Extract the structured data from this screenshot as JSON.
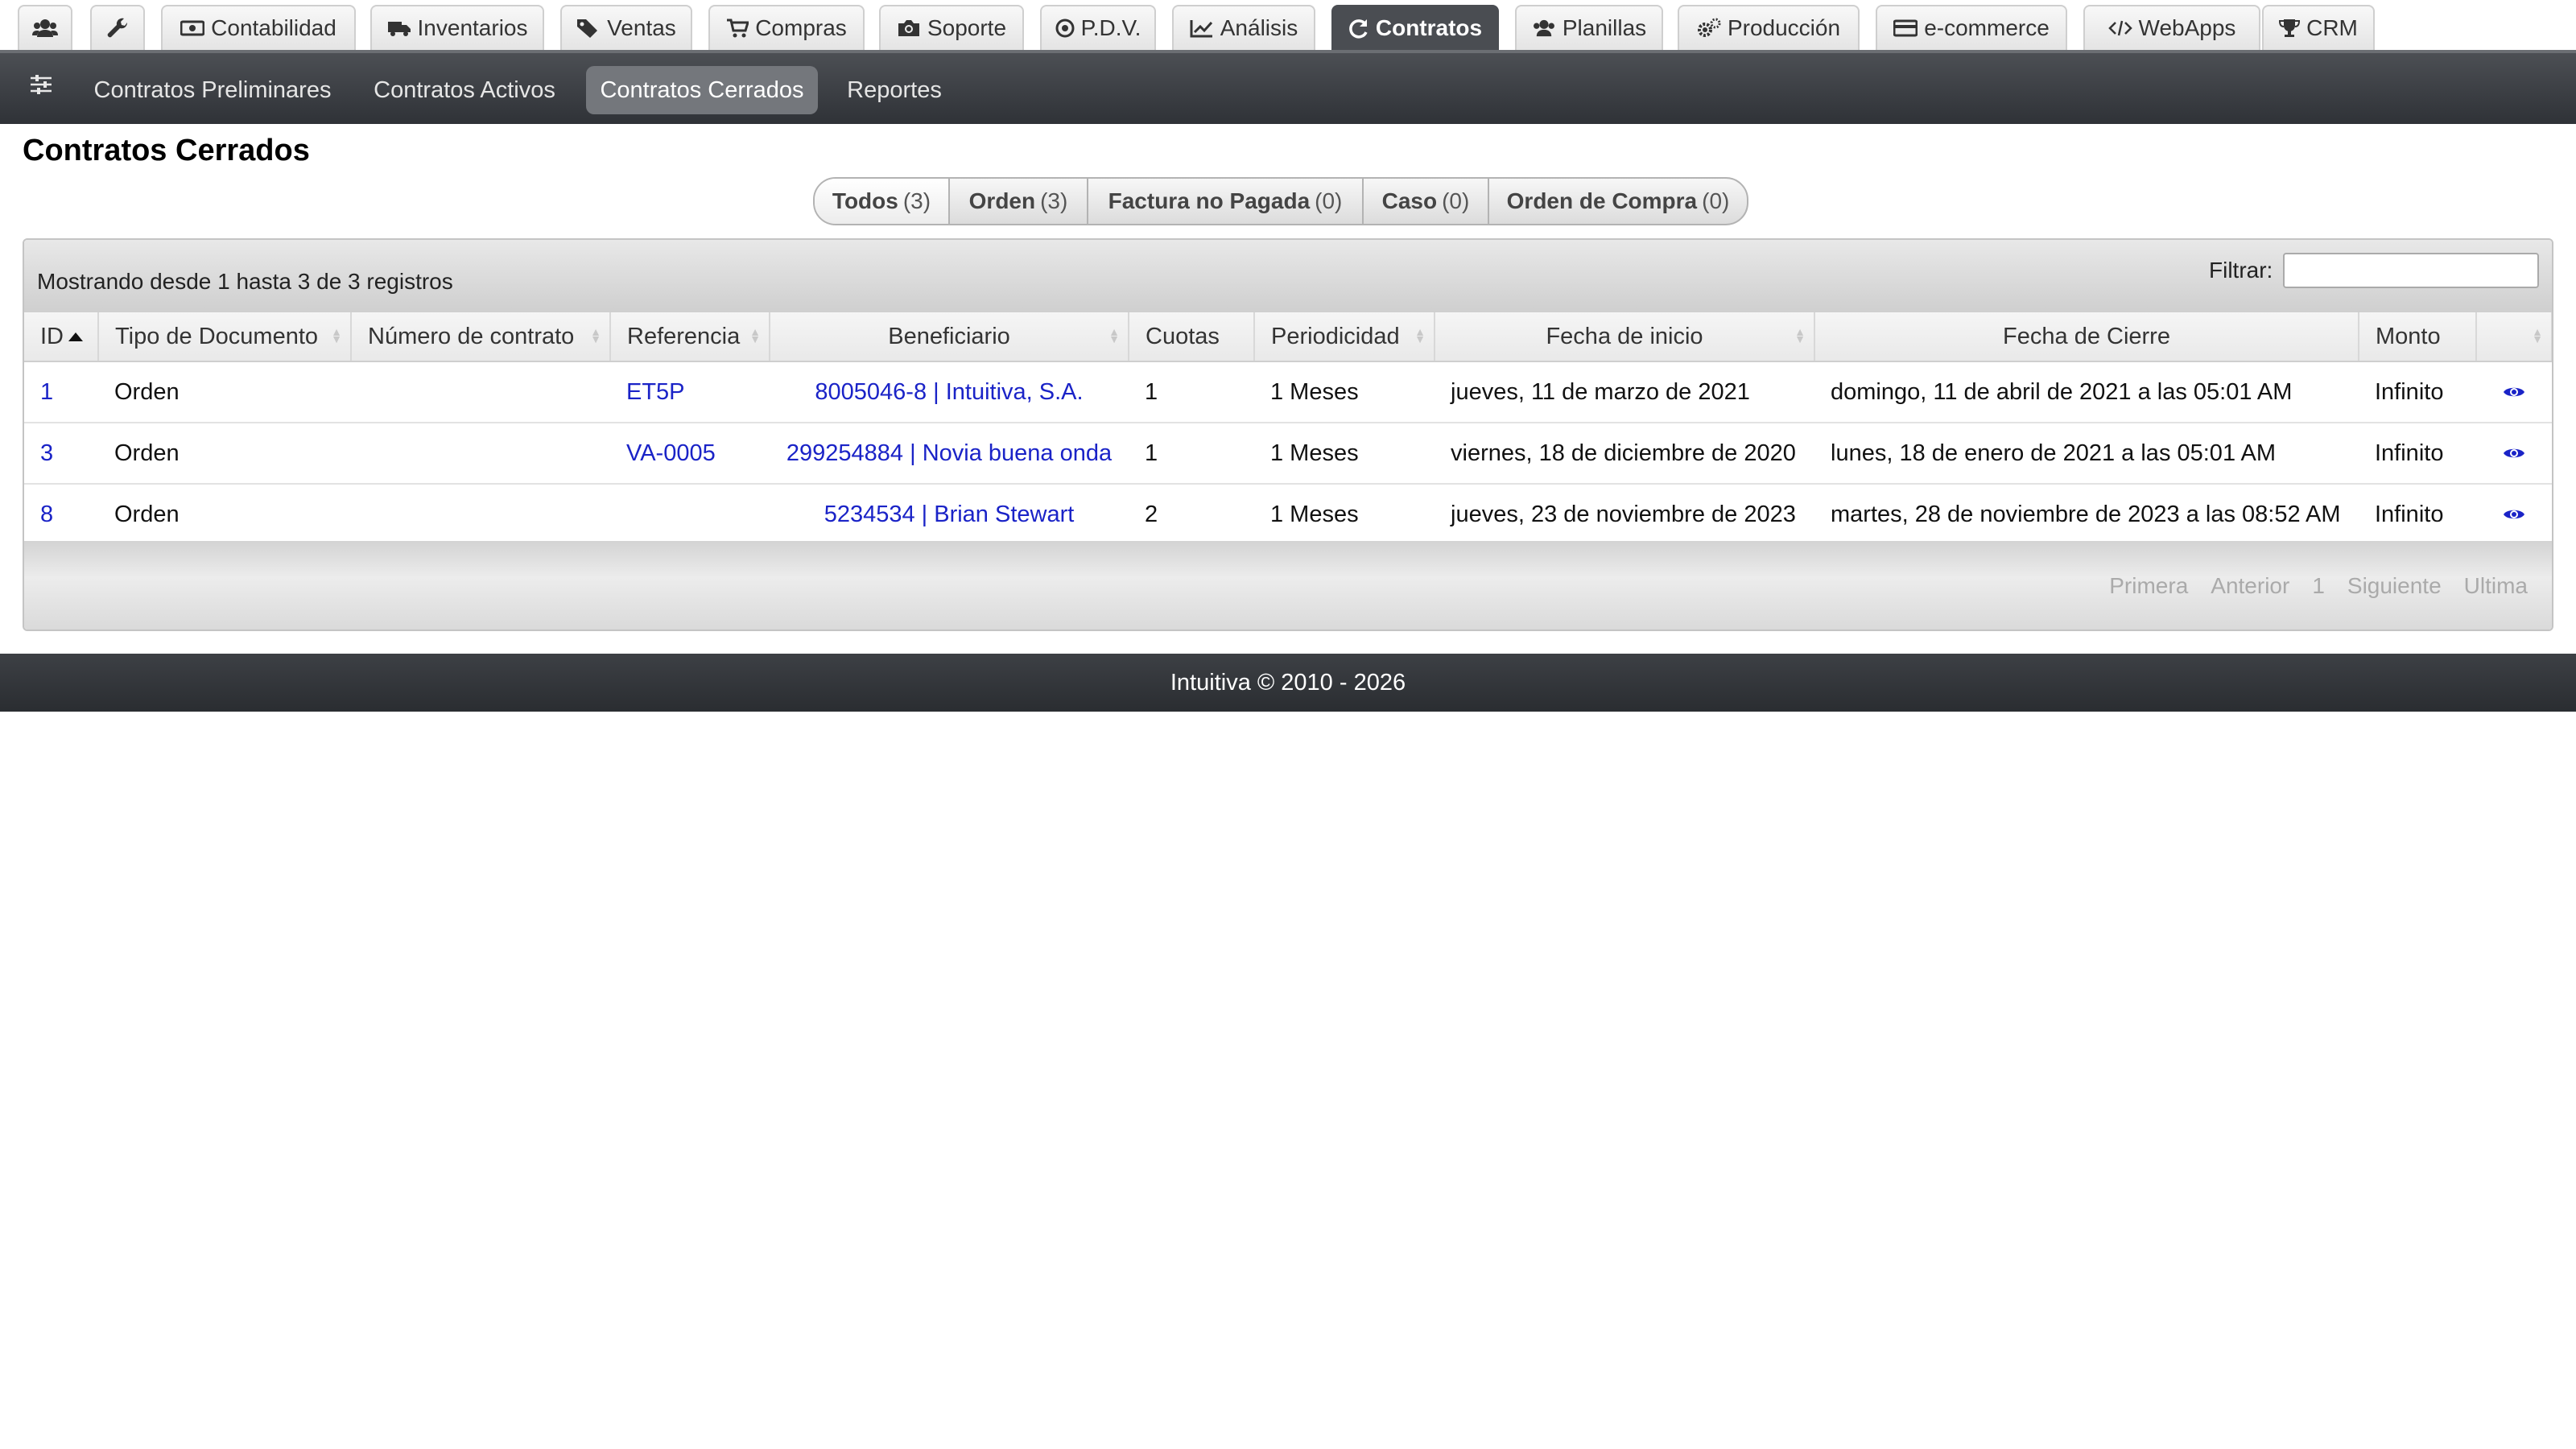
{
  "modules": [
    {
      "name": "users",
      "label": "",
      "icon": "users-icon"
    },
    {
      "name": "tools",
      "label": "",
      "icon": "wrench-icon"
    },
    {
      "name": "contabilidad",
      "label": "Contabilidad",
      "icon": "money-icon"
    },
    {
      "name": "inventarios",
      "label": "Inventarios",
      "icon": "truck-icon"
    },
    {
      "name": "ventas",
      "label": "Ventas",
      "icon": "tags-icon"
    },
    {
      "name": "compras",
      "label": "Compras",
      "icon": "cart-icon"
    },
    {
      "name": "soporte",
      "label": "Soporte",
      "icon": "camera-icon"
    },
    {
      "name": "pdv",
      "label": "P.D.V.",
      "icon": "target-icon"
    },
    {
      "name": "analisis",
      "label": "Análisis",
      "icon": "chart-line-icon"
    },
    {
      "name": "contratos",
      "label": "Contratos",
      "icon": "refresh-icon",
      "active": true
    },
    {
      "name": "planillas",
      "label": "Planillas",
      "icon": "users-icon"
    },
    {
      "name": "produccion",
      "label": "Producción",
      "icon": "gears-icon"
    },
    {
      "name": "ecommerce",
      "label": "e-commerce",
      "icon": "credit-card-icon"
    },
    {
      "name": "webapps",
      "label": "WebApps",
      "icon": "code-icon"
    },
    {
      "name": "crm",
      "label": "CRM",
      "icon": "trophy-icon"
    }
  ],
  "subnav": {
    "icon": "sliders-icon",
    "items": [
      {
        "label": "Contratos Preliminares"
      },
      {
        "label": "Contratos Activos"
      },
      {
        "label": "Contratos Cerrados",
        "active": true
      },
      {
        "label": "Reportes"
      }
    ]
  },
  "page": {
    "title": "Contratos Cerrados"
  },
  "filters": [
    {
      "label": "Todos",
      "count": "(3)"
    },
    {
      "label": "Orden",
      "count": "(3)"
    },
    {
      "label": "Factura no Pagada",
      "count": "(0)"
    },
    {
      "label": "Caso",
      "count": "(0)"
    },
    {
      "label": "Orden de Compra",
      "count": "(0)"
    }
  ],
  "table": {
    "info": "Mostrando desde 1 hasta 3 de 3 registros",
    "filter_label": "Filtrar:",
    "filter_value": "",
    "columns": [
      "ID",
      "Tipo de Documento",
      "Número de contrato",
      "Referencia",
      "Beneficiario",
      "Cuotas",
      "Periodicidad",
      "Fecha de inicio",
      "Fecha de Cierre",
      "Monto",
      ""
    ],
    "rows": [
      {
        "id": "1",
        "tipo": "Orden",
        "numero": "",
        "referencia": "ET5P",
        "beneficiario": "8005046-8 | Intuitiva, S.A.",
        "cuotas": "1",
        "periodicidad": "1 Meses",
        "inicio": "jueves, 11 de marzo de 2021",
        "cierre": "domingo, 11 de abril de 2021 a las 05:01 AM",
        "monto": "Infinito",
        "action_icon": "eye-icon"
      },
      {
        "id": "3",
        "tipo": "Orden",
        "numero": "",
        "referencia": "VA-0005",
        "beneficiario": "299254884 | Novia buena onda",
        "cuotas": "1",
        "periodicidad": "1 Meses",
        "inicio": "viernes, 18 de diciembre de 2020",
        "cierre": "lunes, 18 de enero de 2021 a las 05:01 AM",
        "monto": "Infinito",
        "action_icon": "eye-icon"
      },
      {
        "id": "8",
        "tipo": "Orden",
        "numero": "",
        "referencia": "",
        "beneficiario": "5234534 | Brian Stewart",
        "cuotas": "2",
        "periodicidad": "1 Meses",
        "inicio": "jueves, 23 de noviembre de 2023",
        "cierre": "martes, 28 de noviembre de 2023 a las 08:52 AM",
        "monto": "Infinito",
        "action_icon": "eye-icon"
      }
    ],
    "pager": {
      "first": "Primera",
      "prev": "Anterior",
      "page": "1",
      "next": "Siguiente",
      "last": "Ultima"
    }
  },
  "footer": {
    "text": "Intuitiva © 2010 - 2026"
  },
  "colors": {
    "link": "#1a23c7",
    "nav_dark": "#3a3d42",
    "active_tab": "#4a4d52"
  }
}
